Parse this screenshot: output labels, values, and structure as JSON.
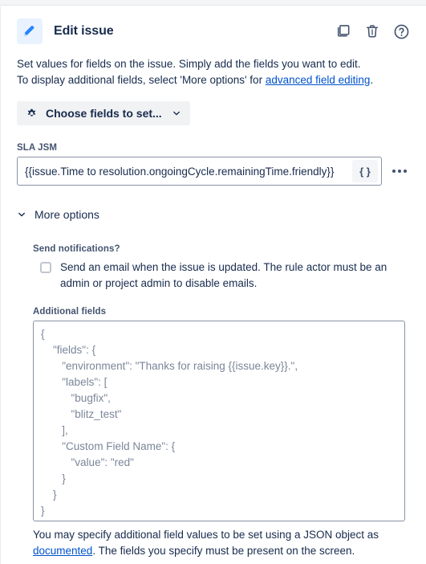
{
  "header": {
    "title": "Edit issue",
    "icon": "pencil-icon",
    "actions": [
      {
        "name": "duplicate-icon",
        "label": "Duplicate"
      },
      {
        "name": "trash-icon",
        "label": "Delete"
      },
      {
        "name": "help-icon",
        "label": "Help"
      }
    ]
  },
  "description": {
    "line1": "Set values for fields on the issue. Simply add the fields you want to edit.",
    "line2_before": "To display additional fields, select 'More options' for ",
    "line2_link": "advanced field editing",
    "line2_after": "."
  },
  "choose_fields": {
    "label": "Choose fields to set...",
    "icon": "gear-icon",
    "chevron": "chevron-down-icon"
  },
  "sla_field": {
    "label": "SLA JSM",
    "value": "{{issue.Time to resolution.ongoingCycle.remainingTime.friendly}}",
    "placeholder": "",
    "smart_value_button": "{ }",
    "more_button": "ellipsis-icon"
  },
  "more_options": {
    "label": "More options",
    "chevron": "chevron-down-icon",
    "expanded": true
  },
  "notifications": {
    "label": "Send notifications?",
    "checkbox_checked": false,
    "checkbox_text": "Send an email when the issue is updated. The rule actor must be an admin or project admin to disable emails."
  },
  "additional_fields": {
    "label": "Additional fields",
    "value": "{\n    \"fields\": {\n       \"environment\": \"Thanks for raising {{issue.key}}.\",\n       \"labels\": [\n          \"bugfix\",\n          \"blitz_test\"\n       ],\n       \"Custom Field Name\": {\n          \"value\": \"red\"\n       }\n    }\n}",
    "help_before": "You may specify additional field values to be set using a JSON object as ",
    "help_link": "documented",
    "help_after": ".",
    "help_line2": "The fields you specify must be present on the screen."
  },
  "colors": {
    "accent": "#0052cc",
    "link": "#0052cc",
    "text": "#172b4d",
    "subtle_text": "#44546f",
    "icon_bg": "#e9f2ff",
    "button_bg": "#f1f2f4",
    "border": "#8993a4",
    "json_text": "#7a8699"
  }
}
